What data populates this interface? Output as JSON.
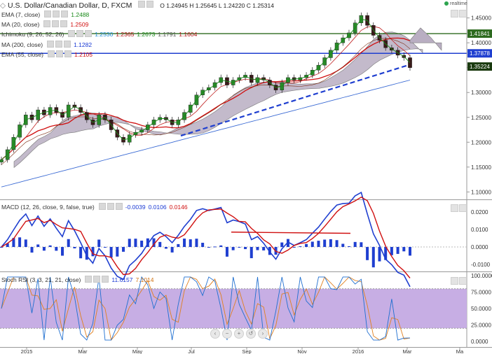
{
  "header": {
    "symbol_label": "U.S. Dollar/Canadian Dollar, D, FXCM",
    "ohlc": "O 1.24945 H 1.25645 L 1.24220 C 1.25314",
    "realtime_label": "realtime"
  },
  "indicators": [
    {
      "label": "EMA (7, close)",
      "value": "1.2488",
      "color": "#1a8a1a"
    },
    {
      "label": "MA (20, close)",
      "value": "1.2509",
      "color": "#d01010"
    },
    {
      "label": "Ichimoku (9, 26, 52, 26)",
      "values": [
        "1.2530",
        "1.2365",
        "1.2673",
        "1.1791",
        "1.1604"
      ],
      "colors": [
        "#1a8ad4",
        "#b01010",
        "#1a8a1a",
        "#555555",
        "#b01010"
      ]
    },
    {
      "label": "MA (200, close)",
      "value": "1.1282",
      "color": "#1a3ad4"
    },
    {
      "label": "EMA (55, close)",
      "value": "1.2105",
      "color": "#d01010"
    }
  ],
  "macd": {
    "label": "MACD (12, 26, close, 9, false, true)",
    "values": [
      "-0.0039",
      "0.0106",
      "0.0146"
    ],
    "colors": [
      "#1a3ad4",
      "#1a3ad4",
      "#d01010"
    ]
  },
  "stoch": {
    "label": "Stoch RSI (3, 3, 21, 21, close)",
    "values": [
      "11.6157",
      "7.1014"
    ],
    "colors": [
      "#1a3ad4",
      "#d07010"
    ]
  },
  "price_axis": {
    "ticks": [
      "1.45000",
      "1.40000",
      "1.35000",
      "1.30000",
      "1.25000",
      "1.20000",
      "1.15000",
      "1.10000"
    ],
    "badges": [
      {
        "text": "1.41841",
        "bg": "#2d6a1f",
        "value": 1.41841
      },
      {
        "text": "1.37878",
        "bg": "#1f3fd0",
        "value": 1.37878
      },
      {
        "text": "1.35224",
        "bg": "#1a3a0f",
        "value": 1.35224
      }
    ]
  },
  "macd_axis": {
    "ticks": [
      "0.0200",
      "0.0100",
      "0.0000",
      "-0.0100"
    ]
  },
  "stoch_axis": {
    "ticks": [
      "100.0000",
      "75.0000",
      "50.0000",
      "25.0000",
      "0.0000"
    ]
  },
  "time_axis": {
    "labels": [
      "2015",
      "Mar",
      "May",
      "Jul",
      "Sep",
      "Nov",
      "2016",
      "Mar",
      "Ma"
    ]
  },
  "nav_icons": [
    "chevron-left-icon",
    "minus-icon",
    "plus-icon",
    "reset-icon",
    "chevron-right-icon"
  ],
  "chart_data": {
    "type": "line",
    "symbol": "USDCAD",
    "timeframe": "D",
    "x_labels": [
      "2015",
      "Mar",
      "May",
      "Jul",
      "Sep",
      "Nov",
      "2016",
      "Mar",
      "Ma"
    ],
    "price_range": [
      1.085,
      1.472
    ],
    "horizontal_lines": [
      {
        "value": 1.41841,
        "color": "#2d6a1f"
      },
      {
        "value": 1.37878,
        "color": "#1f3fd0"
      }
    ],
    "close_series": [
      1.165,
      1.185,
      1.21,
      1.235,
      1.255,
      1.245,
      1.265,
      1.255,
      1.27,
      1.26,
      1.25,
      1.275,
      1.27,
      1.26,
      1.245,
      1.235,
      1.255,
      1.245,
      1.225,
      1.21,
      1.2,
      1.215,
      1.22,
      1.225,
      1.235,
      1.245,
      1.25,
      1.245,
      1.235,
      1.245,
      1.26,
      1.275,
      1.295,
      1.305,
      1.31,
      1.32,
      1.33,
      1.315,
      1.325,
      1.33,
      1.335,
      1.32,
      1.33,
      1.325,
      1.315,
      1.305,
      1.32,
      1.33,
      1.325,
      1.33,
      1.335,
      1.345,
      1.355,
      1.37,
      1.385,
      1.4,
      1.41,
      1.42,
      1.44,
      1.455,
      1.435,
      1.415,
      1.405,
      1.39,
      1.385,
      1.375,
      1.37,
      1.35
    ],
    "macd_range": [
      -0.014,
      0.026
    ],
    "stoch_range": [
      0,
      100
    ],
    "stoch_band": [
      20,
      80
    ]
  }
}
